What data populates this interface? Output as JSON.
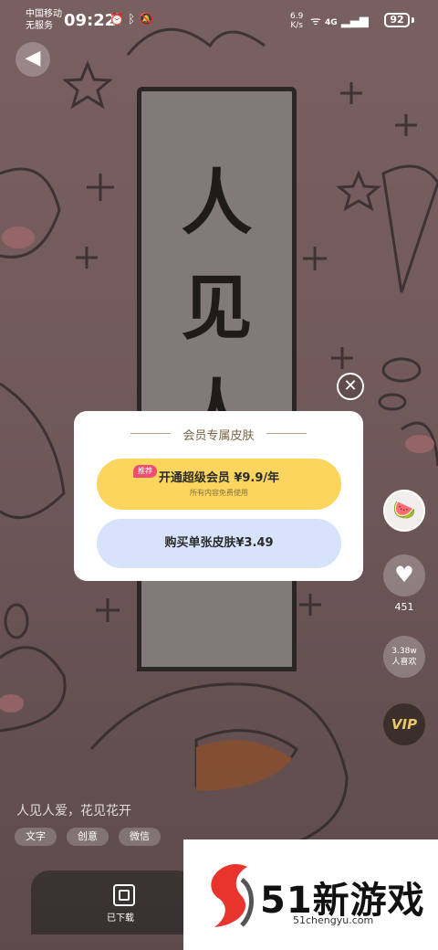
{
  "status_bar": {
    "carrier_line1": "中国移动",
    "carrier_line2": "无服务",
    "time": "09:22",
    "net_speed_value": "6.9",
    "net_speed_unit": "K/s",
    "signal": "4G",
    "battery": "92"
  },
  "wallpaper": {
    "banner_chars": [
      "人",
      "见",
      "人"
    ]
  },
  "modal": {
    "title": "会员专属皮肤",
    "vip_tag": "推荐",
    "vip_label": "开通超级会员 ¥9.9/年",
    "vip_sub": "所有内容免费使用",
    "single_label": "购买单张皮肤¥3.49"
  },
  "side": {
    "like_count": "451",
    "likes_line1": "3.38w",
    "likes_line2": "人喜欢",
    "vip_badge": "VIP"
  },
  "caption": "人见人爱，花见花开",
  "chips": [
    "文字",
    "创意",
    "微信"
  ],
  "bottom": {
    "downloaded_label": "已下载"
  },
  "watermark": {
    "brand": "51新游戏",
    "url": "51chengyu.com"
  }
}
